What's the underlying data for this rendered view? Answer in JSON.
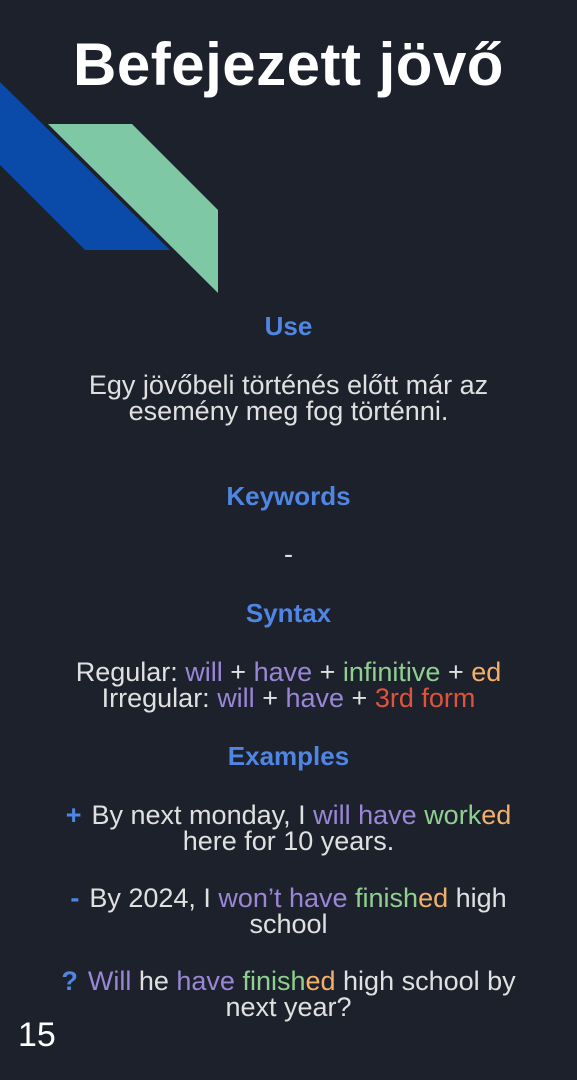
{
  "title": "Befejezett jövő",
  "colors": {
    "background": "#1c212c",
    "heading": "#4f86e3",
    "shape_blue": "#0a4aa8",
    "shape_green": "#7ec8a6",
    "verb_purple": "#9b86d6",
    "infinitive_green": "#8fd08f",
    "suffix_orange": "#f2b06a",
    "third_form_red": "#e0533b"
  },
  "use": {
    "heading": "Use",
    "text": "Egy jövőbeli történés előtt már az esemény meg fog történni."
  },
  "keywords": {
    "heading": "Keywords",
    "text": "-"
  },
  "syntax": {
    "heading": "Syntax",
    "regular": {
      "label": "Regular: ",
      "will": "will",
      "plus1": " + ",
      "have": "have",
      "plus2": " +  ",
      "infinitive": "infinitive",
      "plus3": " + ",
      "ed": "ed"
    },
    "irregular": {
      "label": "Irregular: ",
      "will": "will",
      "plus1": " + ",
      "have": "have",
      "plus2": " + ",
      "form": "3rd form"
    }
  },
  "examples": {
    "heading": "Examples",
    "positive": {
      "sign": "+",
      "pre": "By next monday, I ",
      "will_have": "will have",
      "space": " ",
      "verb_stem": "work",
      "verb_suffix": "ed",
      "line2": "here for 10 years."
    },
    "negative": {
      "sign": "-",
      "pre": "By 2024, I ",
      "wont_have": "won’t have",
      "space": " ",
      "verb_stem": "finish",
      "verb_suffix": "ed",
      "post": " high",
      "line2": "school"
    },
    "question": {
      "sign": "?",
      "will": "Will",
      "he": " he ",
      "have": "have",
      "space": " ",
      "verb_stem": "finish",
      "verb_suffix": "ed",
      "post": " high school by",
      "line2": "next year?"
    }
  },
  "page_number": "15"
}
